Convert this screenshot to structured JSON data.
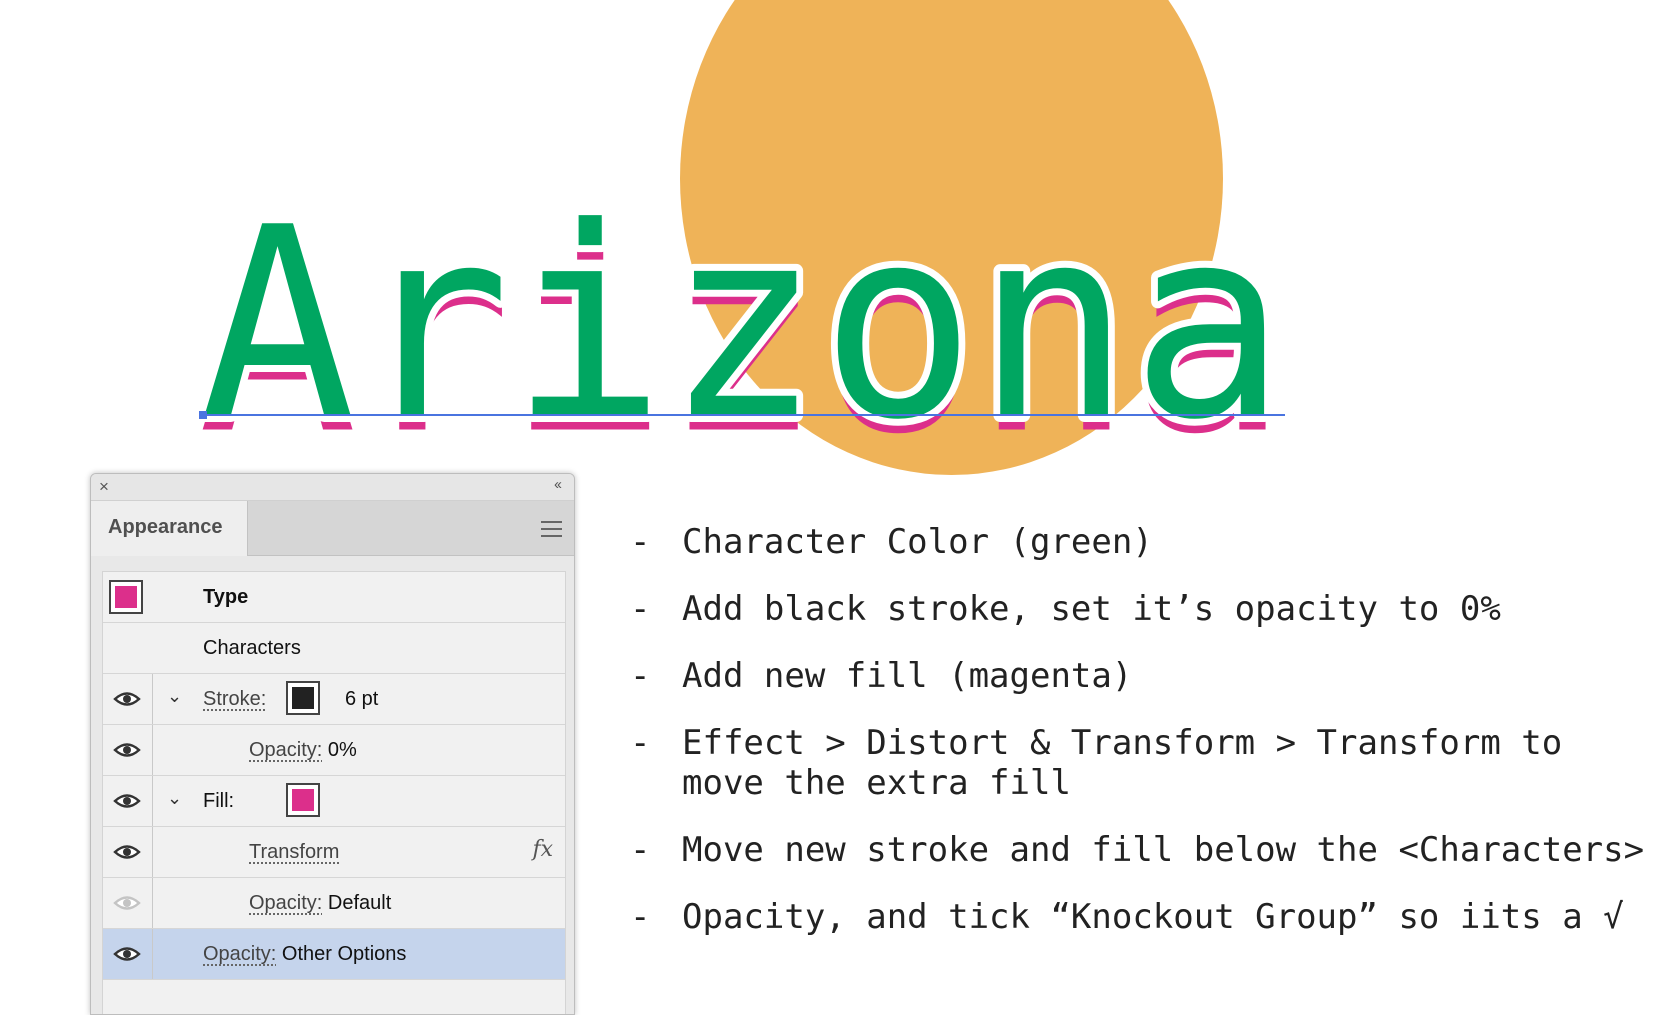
{
  "artwork": {
    "word": "Arizona",
    "fill_color": "#00a661",
    "offset_fill_color": "#dc2f8b",
    "sun_color": "#efb358",
    "baseline_color": "#4a74e0"
  },
  "panel": {
    "close_icon": "×",
    "collapse_icon": "‹‹",
    "tab_label": "Appearance",
    "menu_icon": "hamburger-menu-icon",
    "rows": {
      "type_label": "Type",
      "type_swatch": "#dc2f8b",
      "characters_label": "Characters",
      "stroke_label": "Stroke:",
      "stroke_swatch": "#222222",
      "stroke_value": "6 pt",
      "stroke_opacity_label": "Opacity:",
      "stroke_opacity_value": "0%",
      "fill_label": "Fill:",
      "fill_swatch": "#dc2f8b",
      "transform_label": "Transform",
      "fx_label": "fx",
      "fill_opacity_label": "Opacity:",
      "fill_opacity_value": "Default",
      "layer_opacity_label": "Opacity:",
      "layer_opacity_value": "Other Options"
    }
  },
  "steps": [
    "Character Color (green)",
    "Add black stroke, set it’s opacity to 0%",
    "Add new fill (magenta)",
    "Effect > Distort & Transform > Transform to move the extra fill",
    "Move new stroke and fill below the <Characters>",
    "Opacity, and tick “Knockout Group” so iits a √"
  ],
  "step_bullet": "-"
}
